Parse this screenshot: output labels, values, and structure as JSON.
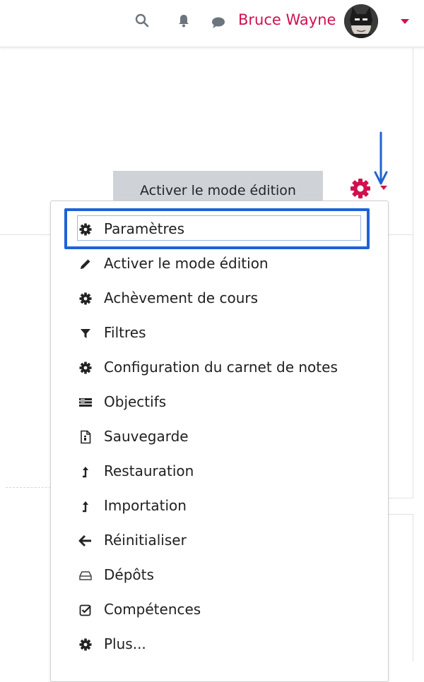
{
  "navbar": {
    "user_name": "Bruce Wayne",
    "icons": [
      "search-icon",
      "bell-icon",
      "chat-icon",
      "caret-down-icon"
    ],
    "accent_color": "#d0114f"
  },
  "actions": {
    "edit_mode_button": "Activer le mode édition",
    "settings_icon": "gear-icon",
    "settings_color": "#d0114f"
  },
  "menu": {
    "items": [
      {
        "label": "Paramètres",
        "icon": "gear-icon",
        "focused": true
      },
      {
        "label": "Activer le mode édition",
        "icon": "pencil-icon"
      },
      {
        "label": "Achèvement de cours",
        "icon": "gear-icon"
      },
      {
        "label": "Filtres",
        "icon": "filter-icon"
      },
      {
        "label": "Configuration du carnet de notes",
        "icon": "gear-icon"
      },
      {
        "label": "Objectifs",
        "icon": "list-icon"
      },
      {
        "label": "Sauvegarde",
        "icon": "file-archive-icon"
      },
      {
        "label": "Restauration",
        "icon": "level-up-icon"
      },
      {
        "label": "Importation",
        "icon": "level-up-icon"
      },
      {
        "label": "Réinitialiser",
        "icon": "arrow-left-icon"
      },
      {
        "label": "Dépôts",
        "icon": "hdd-icon"
      },
      {
        "label": "Compétences",
        "icon": "check-square-icon"
      },
      {
        "label": "Plus...",
        "icon": "gear-icon"
      }
    ]
  },
  "annotation": {
    "color": "#1e63d6"
  }
}
